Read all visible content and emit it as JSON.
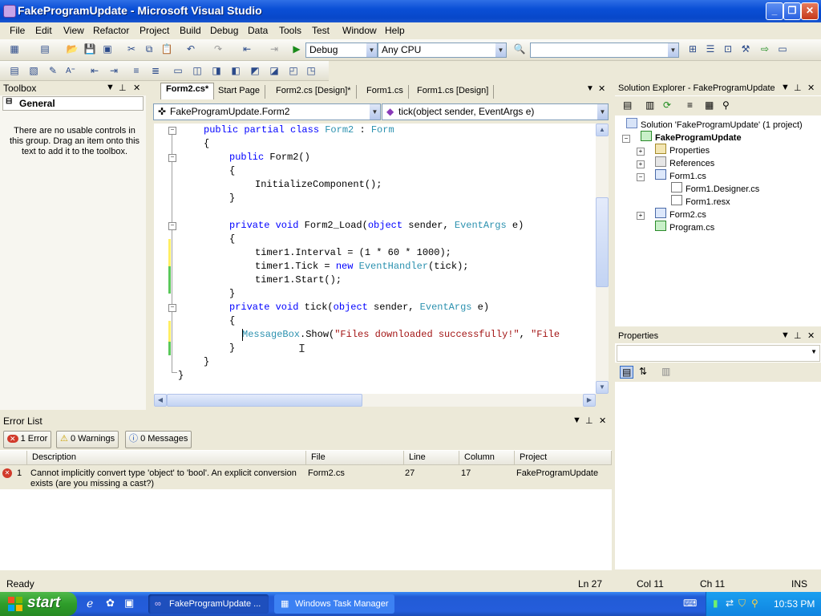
{
  "window": {
    "title": "FakeProgramUpdate - Microsoft Visual Studio"
  },
  "menu": [
    "File",
    "Edit",
    "View",
    "Refactor",
    "Project",
    "Build",
    "Debug",
    "Data",
    "Tools",
    "Test",
    "Window",
    "Help"
  ],
  "toolbar": {
    "config": "Debug",
    "platform": "Any CPU",
    "find": ""
  },
  "toolbox": {
    "title": "Toolbox",
    "group": "General",
    "empty_text": "There are no usable controls in this group. Drag an item onto this text to add it to the toolbox."
  },
  "editor": {
    "tabs": [
      "Form2.cs*",
      "Start Page",
      "Form2.cs [Design]*",
      "Form1.cs",
      "Form1.cs [Design]"
    ],
    "class_combo": "FakeProgramUpdate.Form2",
    "member_combo": "tick(object sender, EventArgs e)"
  },
  "solution_explorer": {
    "title": "Solution Explorer - FakeProgramUpdate",
    "solution": "Solution 'FakeProgramUpdate' (1 project)",
    "project": "FakeProgramUpdate",
    "items": [
      "Properties",
      "References",
      "Form1.cs",
      "Form1.Designer.cs",
      "Form1.resx",
      "Form2.cs",
      "Program.cs"
    ]
  },
  "properties": {
    "title": "Properties"
  },
  "error_list": {
    "title": "Error List",
    "errors_btn": "1 Error",
    "warnings_btn": "0 Warnings",
    "messages_btn": "0 Messages",
    "columns": [
      "Description",
      "File",
      "Line",
      "Column",
      "Project"
    ],
    "rows": [
      {
        "num": "1",
        "description": "Cannot implicitly convert type 'object' to 'bool'. An explicit conversion exists (are you missing a cast?)",
        "file": "Form2.cs",
        "line": "27",
        "column": "17",
        "project": "FakeProgramUpdate"
      }
    ]
  },
  "status": {
    "ready": "Ready",
    "ln": "Ln 27",
    "col": "Col 11",
    "ch": "Ch 11",
    "ins": "INS"
  },
  "taskbar": {
    "start": "start",
    "item1": "FakeProgramUpdate ...",
    "item2": "Windows Task Manager",
    "clock": "10:53 PM"
  },
  "colors": {
    "keyword": "#0000ff",
    "type": "#2b91af",
    "string": "#a31515",
    "titlebar": "#0a4fd6",
    "start": "#2e9d2a"
  }
}
